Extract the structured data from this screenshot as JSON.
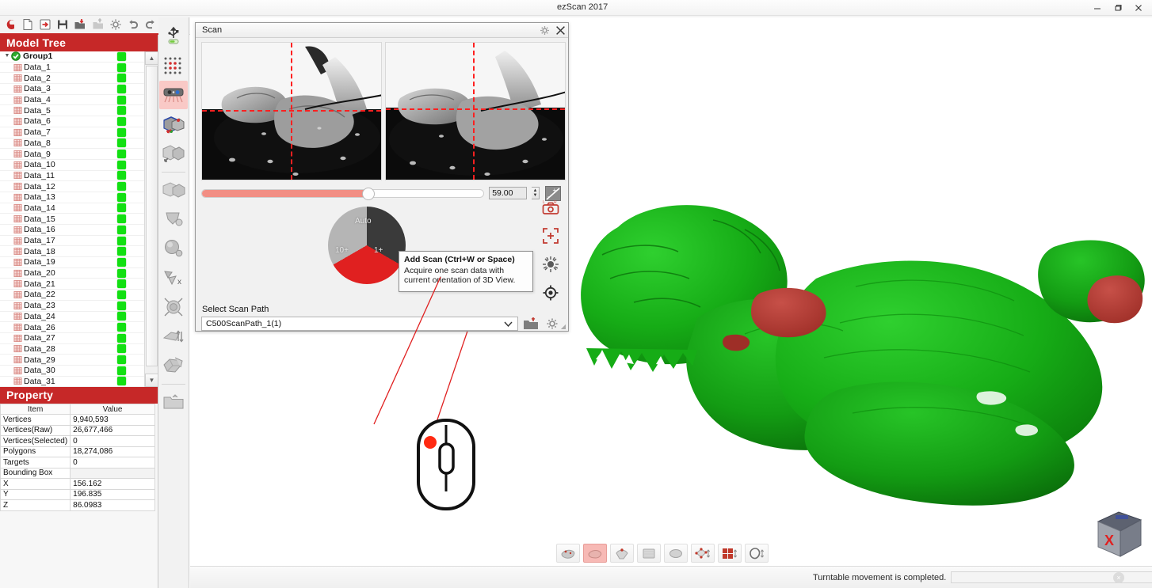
{
  "window": {
    "title": "ezScan 2017",
    "minimize": "–",
    "maximize": "❐",
    "close": "×"
  },
  "top_toolbar": {
    "buttons": [
      {
        "name": "app-logo-icon",
        "label": "ezScan"
      },
      {
        "name": "new-document-icon",
        "label": "New"
      },
      {
        "name": "open-project-icon",
        "label": "Open Project"
      },
      {
        "name": "save-icon",
        "label": "Save"
      },
      {
        "name": "import-icon",
        "label": "Import"
      },
      {
        "name": "export-icon",
        "label": "Export"
      },
      {
        "name": "settings-gear-icon",
        "label": "Settings"
      },
      {
        "name": "undo-icon",
        "label": "Undo"
      },
      {
        "name": "redo-icon",
        "label": "Redo"
      }
    ]
  },
  "model_tree": {
    "title": "Model Tree",
    "group": {
      "label": "Group1",
      "visible": true
    },
    "items": [
      "Data_1",
      "Data_2",
      "Data_3",
      "Data_4",
      "Data_5",
      "Data_6",
      "Data_7",
      "Data_8",
      "Data_9",
      "Data_10",
      "Data_11",
      "Data_12",
      "Data_13",
      "Data_14",
      "Data_15",
      "Data_16",
      "Data_17",
      "Data_18",
      "Data_19",
      "Data_20",
      "Data_21",
      "Data_22",
      "Data_23",
      "Data_24",
      "Data_26",
      "Data_27",
      "Data_28",
      "Data_29",
      "Data_30",
      "Data_31"
    ]
  },
  "property": {
    "title": "Property",
    "columns": [
      "Item",
      "Value"
    ],
    "rows": [
      {
        "item": "Vertices",
        "value": "9,940,593"
      },
      {
        "item": "Vertices(Raw)",
        "value": "26,677,466"
      },
      {
        "item": "Vertices(Selected)",
        "value": "0"
      },
      {
        "item": "Polygons",
        "value": "18,274,086"
      },
      {
        "item": "Targets",
        "value": "0"
      },
      {
        "item": "Bounding Box",
        "value": ""
      },
      {
        "item": "X",
        "value": "156.162"
      },
      {
        "item": "Y",
        "value": "196.835"
      },
      {
        "item": "Z",
        "value": "86.0983"
      }
    ]
  },
  "vertical_toolbar": {
    "buttons": [
      {
        "name": "usb-device-icon",
        "label": "Device Connection"
      },
      {
        "name": "calibration-board-icon",
        "label": "Calibration"
      },
      {
        "name": "scanner-head-icon",
        "label": "Scan",
        "active": true
      },
      {
        "name": "align-datasets-icon",
        "label": "Align"
      },
      {
        "name": "merge-mesh-icon",
        "label": "Merge"
      },
      {
        "name": "global-registration-icon",
        "label": "Global Registration"
      },
      {
        "name": "fill-holes-icon",
        "label": "Fill Holes"
      },
      {
        "name": "smooth-surface-icon",
        "label": "Smooth"
      },
      {
        "name": "delete-selection-icon",
        "label": "Delete Selection"
      },
      {
        "name": "optimize-mesh-icon",
        "label": "Optimize"
      },
      {
        "name": "decimate-icon",
        "label": "Decimate"
      },
      {
        "name": "shell-mesh-icon",
        "label": "Shell"
      },
      {
        "name": "open-folder-icon",
        "label": "Open Folder"
      }
    ]
  },
  "scan_dialog": {
    "title": "Scan",
    "settings_icon": "gear-icon",
    "close_icon": "close-icon",
    "exposure": {
      "value": "59.00",
      "slider_percent": 59,
      "up_arrow": "▲",
      "down_arrow": "▼"
    },
    "pie": {
      "segments": [
        {
          "label": "Auto",
          "color": "#3a3a3a"
        },
        {
          "label": "1+",
          "color": "#e02020"
        },
        {
          "label": "10+",
          "color": "#b5b5b5"
        }
      ]
    },
    "tooltip": {
      "title": "Add Scan (Ctrl+W or Space)",
      "line1": "Acquire one scan data with",
      "line2": "current orientation of 3D View."
    },
    "side_icons": [
      {
        "name": "camera-capture-icon",
        "label": "Capture"
      },
      {
        "name": "crosshair-frame-icon",
        "label": "Region of Interest"
      },
      {
        "name": "brightness-sun-icon",
        "label": "Brightness"
      },
      {
        "name": "focus-target-icon",
        "label": "Focus"
      }
    ],
    "scan_path": {
      "label": "Select Scan Path",
      "value": "C500ScanPath_1(1)",
      "caret": "∨",
      "open_icon": "open-folder-icon",
      "settings_icon": "gear-icon"
    }
  },
  "viewport": {
    "bottom_toolbar": [
      {
        "name": "render-points-icon",
        "label": "Point Cloud"
      },
      {
        "name": "render-shaded-icon",
        "label": "Shaded",
        "active": true
      },
      {
        "name": "render-wireframe-icon",
        "label": "Wireframe"
      },
      {
        "name": "render-flat-icon",
        "label": "Flat"
      },
      {
        "name": "render-smooth-icon",
        "label": "Smooth"
      },
      {
        "name": "bounding-box-icon",
        "label": "Bounding Box"
      },
      {
        "name": "grid-view-icon",
        "label": "Grid"
      },
      {
        "name": "transparency-icon",
        "label": "Transparency"
      }
    ],
    "nav_cube_label": "X",
    "mouse_annotation": {
      "name": "mouse-left-click-illustration"
    }
  },
  "status_bar": {
    "message": "Turntable movement is completed.",
    "close_icon": "×"
  },
  "colors": {
    "brand_red": "#c62828",
    "accent_red": "#e02020",
    "mesh_green": "#14aa14",
    "mesh_red": "#b33a33",
    "slider_fill": "#f28e84",
    "indicator_green": "#12e012"
  }
}
